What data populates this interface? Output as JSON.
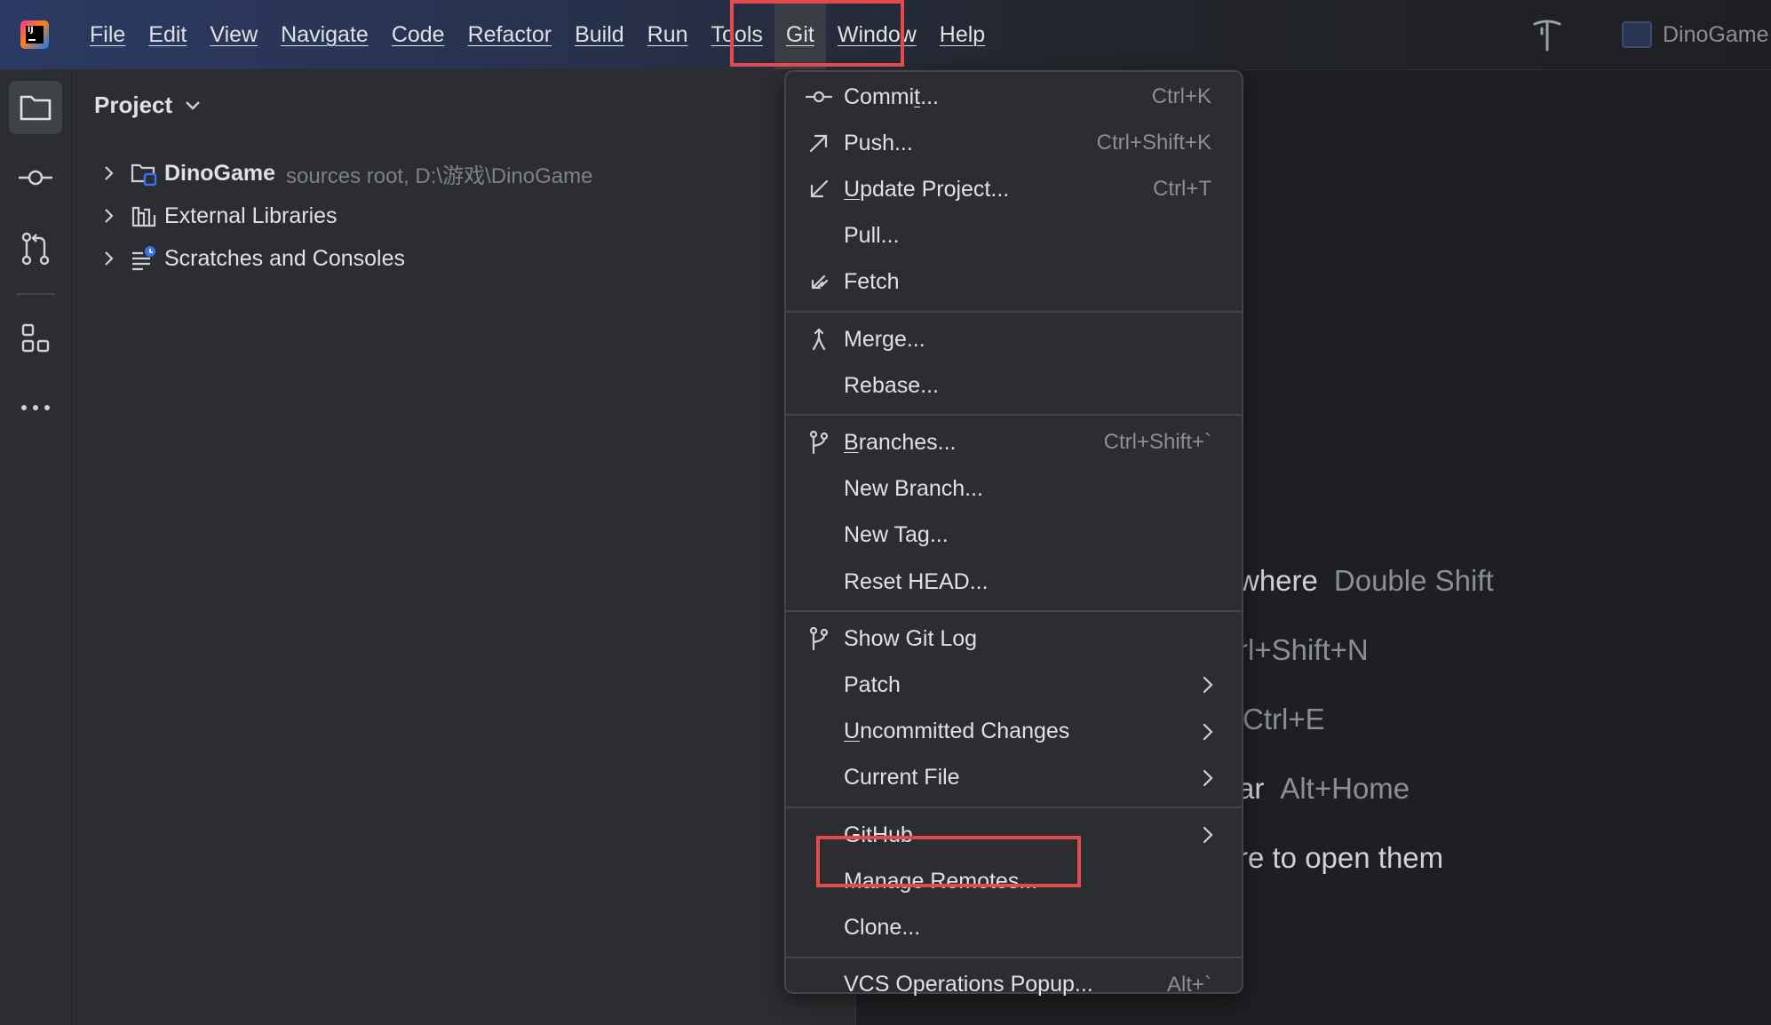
{
  "app": {
    "logo_text": "IJ"
  },
  "menubar": {
    "items": [
      {
        "label": "File"
      },
      {
        "label": "Edit"
      },
      {
        "label": "View"
      },
      {
        "label": "Navigate"
      },
      {
        "label": "Code"
      },
      {
        "label": "Refactor"
      },
      {
        "label": "Build"
      },
      {
        "label": "Run"
      },
      {
        "label": "Tools"
      },
      {
        "label": "Git"
      },
      {
        "label": "Window"
      },
      {
        "label": "Help"
      }
    ],
    "active": "Git"
  },
  "titlebar": {
    "project_name": "DinoGame"
  },
  "project_panel": {
    "title": "Project",
    "tree": [
      {
        "label": "DinoGame",
        "hint": "sources root,  D:\\游戏\\DinoGame"
      },
      {
        "label": "External Libraries"
      },
      {
        "label": "Scratches and Consoles"
      }
    ]
  },
  "editor_hints": [
    {
      "action": "where",
      "key": "Double Shift"
    },
    {
      "action": "rl+Shift+N",
      "key": ""
    },
    {
      "action": "Ctrl+E",
      "key": ""
    },
    {
      "action": "ar",
      "key": "Alt+Home"
    },
    {
      "action": "re to open them",
      "key": ""
    }
  ],
  "git_menu": {
    "groups": [
      [
        {
          "icon": "commit-icon",
          "label": "Commit...",
          "shortcut": "Ctrl+K"
        },
        {
          "icon": "push-icon",
          "label": "Push...",
          "shortcut": "Ctrl+Shift+K"
        },
        {
          "icon": "update-project-icon",
          "label": "Update Project...",
          "shortcut": "Ctrl+T"
        },
        {
          "icon": "",
          "label": "Pull...",
          "shortcut": ""
        },
        {
          "icon": "fetch-icon",
          "label": "Fetch",
          "shortcut": ""
        }
      ],
      [
        {
          "icon": "merge-icon",
          "label": "Merge...",
          "shortcut": ""
        },
        {
          "icon": "",
          "label": "Rebase...",
          "shortcut": ""
        }
      ],
      [
        {
          "icon": "branch-icon",
          "label": "Branches...",
          "shortcut": "Ctrl+Shift+`"
        },
        {
          "icon": "",
          "label": "New Branch...",
          "shortcut": ""
        },
        {
          "icon": "",
          "label": "New Tag...",
          "shortcut": ""
        },
        {
          "icon": "",
          "label": "Reset HEAD...",
          "shortcut": ""
        }
      ],
      [
        {
          "icon": "git-log-icon",
          "label": "Show Git Log",
          "shortcut": ""
        },
        {
          "icon": "",
          "label": "Patch",
          "shortcut": "",
          "submenu": true
        },
        {
          "icon": "",
          "label": "Uncommitted Changes",
          "shortcut": "",
          "submenu": true
        },
        {
          "icon": "",
          "label": "Current File",
          "shortcut": "",
          "submenu": true
        }
      ],
      [
        {
          "icon": "",
          "label": "GitHub",
          "shortcut": "",
          "submenu": true
        },
        {
          "icon": "",
          "label": "Manage Remotes...",
          "shortcut": "",
          "highlighted": true
        },
        {
          "icon": "",
          "label": "Clone...",
          "shortcut": ""
        }
      ],
      [
        {
          "icon": "",
          "label": "VCS Operations Popup...",
          "shortcut": "Alt+`"
        }
      ]
    ]
  },
  "colors": {
    "highlight_box": "#e5484d",
    "menu_bg": "#2b2d30",
    "editor_bg": "#1e1f22",
    "text": "#dfe1e5",
    "muted": "#8b8e94"
  }
}
